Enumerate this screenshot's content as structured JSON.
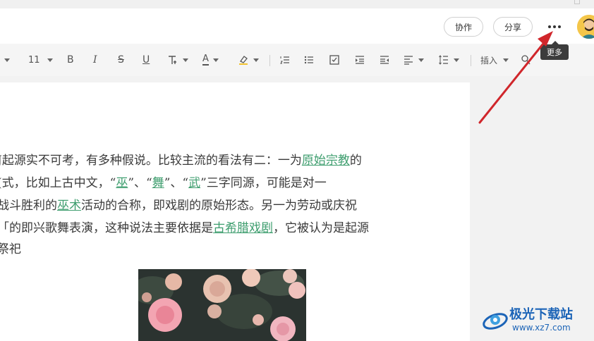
{
  "header": {
    "collab_label": "协作",
    "share_label": "分享",
    "more_tooltip": "更多"
  },
  "toolbar": {
    "font_size": "11",
    "bold": "B",
    "italic": "I",
    "strike": "S",
    "underline": "U",
    "font_color": "A",
    "insert_label": "插入"
  },
  "document": {
    "lines": [
      {
        "segments": [
          {
            "text": "J起源实不可考，有多种假说。比较主流的看法有二：一为",
            "link": false
          },
          {
            "text": "原始宗教",
            "link": true
          },
          {
            "text": "的",
            "link": false
          }
        ]
      },
      {
        "segments": [
          {
            "text": "(式，比如上古中文，“",
            "link": false
          },
          {
            "text": "巫",
            "link": true
          },
          {
            "text": "”、“",
            "link": false
          },
          {
            "text": "舞",
            "link": true
          },
          {
            "text": "”、“",
            "link": false
          },
          {
            "text": "武",
            "link": true
          },
          {
            "text": "”三字同源，可能是对一",
            "link": false
          }
        ]
      },
      {
        "segments": [
          {
            "text": "战斗胜利的",
            "link": false
          },
          {
            "text": "巫术",
            "link": true
          },
          {
            "text": "活动的合称，即戏剧的原始形态。另一为劳动或庆祝",
            "link": false
          }
        ]
      },
      {
        "segments": [
          {
            "text": "「的即兴歌舞表演，这种说法主要依据是",
            "link": false
          },
          {
            "text": "古希腊戏剧",
            "link": true
          },
          {
            "text": "，它被认为是起源",
            "link": false
          }
        ]
      },
      {
        "segments": [
          {
            "text": "祭祀",
            "link": false
          }
        ]
      }
    ]
  },
  "watermark": {
    "name": "极光下载站",
    "url": "www.xz7.com"
  },
  "colors": {
    "link": "#3f9e6f",
    "arrow": "#d0262b",
    "tooltip_bg": "#3c3c3c",
    "watermark": "#1c64b7"
  }
}
